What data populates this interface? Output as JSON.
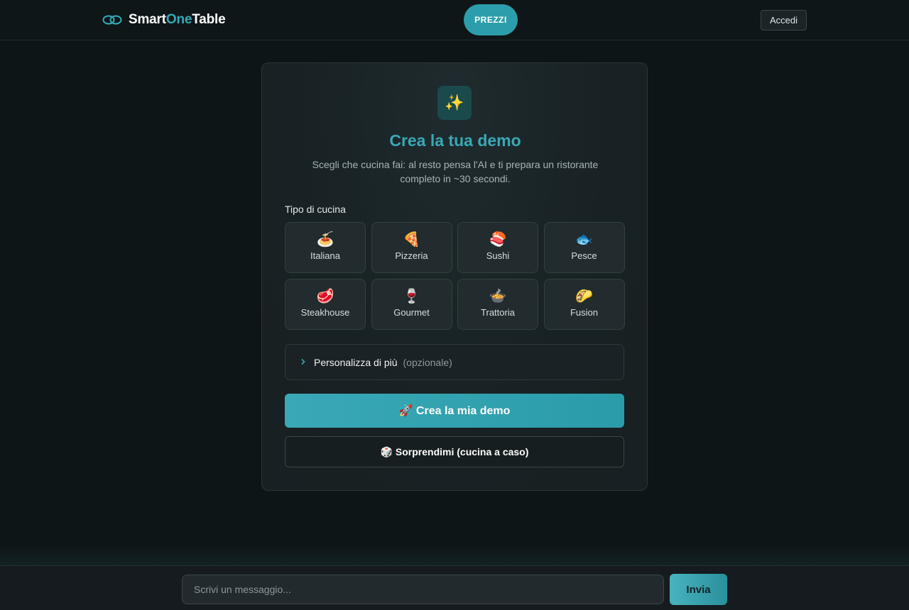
{
  "header": {
    "brand_part1": "Smart",
    "brand_part2": "One",
    "brand_part3": "Table",
    "pricing_label": "PREZZI",
    "login_label": "Accedi",
    "logo_icon": "link-icon"
  },
  "colors": {
    "accent": "#35a9b8",
    "background": "#0e1517",
    "card": "#182123"
  },
  "demo": {
    "icon": "✨",
    "title": "Crea la tua demo",
    "subtitle": "Scegli che cucina fai: al resto pensa l'AI e ti prepara un ristorante completo in ~30 secondi.",
    "cuisine_label": "Tipo di cucina",
    "cuisines": [
      {
        "emoji": "🍝",
        "label": "Italiana"
      },
      {
        "emoji": "🍕",
        "label": "Pizzeria"
      },
      {
        "emoji": "🍣",
        "label": "Sushi"
      },
      {
        "emoji": "🐟",
        "label": "Pesce"
      },
      {
        "emoji": "🥩",
        "label": "Steakhouse"
      },
      {
        "emoji": "🍷",
        "label": "Gourmet"
      },
      {
        "emoji": "🍲",
        "label": "Trattoria"
      },
      {
        "emoji": "🌮",
        "label": "Fusion"
      }
    ],
    "customize_label": "Personalizza di più",
    "customize_optional": "(opzionale)",
    "create_label": "🚀 Crea la mia demo",
    "surprise_label": "🎲 Sorprendimi (cucina a caso)"
  },
  "chat": {
    "placeholder": "Scrivi un messaggio...",
    "value": "",
    "send_label": "Invia"
  }
}
